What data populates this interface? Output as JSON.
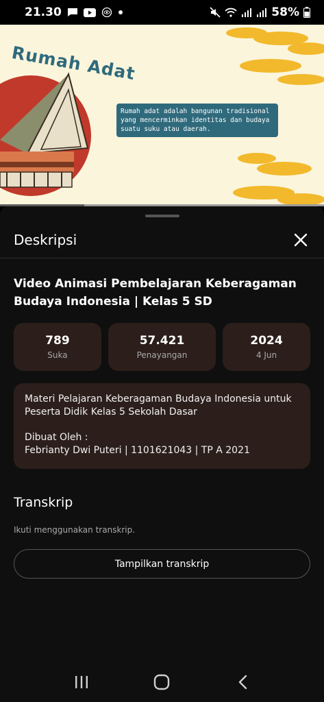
{
  "status_bar": {
    "time": "21.30",
    "battery": "58%",
    "icons": [
      "message-icon",
      "youtube-icon",
      "eye-icon",
      "dot-icon",
      "mute-icon",
      "wifi-icon",
      "signal-icon",
      "signal-icon",
      "battery-icon"
    ]
  },
  "video": {
    "overlay_title": "Rumah Adat",
    "overlay_caption": "Rumah adat adalah bangunan tradisional yang mencerminkan identitas dan budaya suatu suku atau daerah.",
    "progress_fraction": 0.26
  },
  "sheet": {
    "title": "Deskripsi",
    "video_title": "Video Animasi Pembelajaran Keberagaman Budaya Indonesia | Kelas 5 SD",
    "stats": [
      {
        "value": "789",
        "label": "Suka"
      },
      {
        "value": "57.421",
        "label": "Penayangan"
      },
      {
        "value": "2024",
        "label": "4 Jun"
      }
    ],
    "description_line1": "Materi Pelajaran Keberagaman Budaya Indonesia untuk Peserta Didik Kelas 5 Sekolah Dasar",
    "description_line2": "Dibuat Oleh :",
    "description_line3": "Febrianty Dwi Puteri | 1101621043 | TP A 2021",
    "transcript_heading": "Transkrip",
    "transcript_hint": "Ikuti menggunakan transkrip.",
    "transcript_button": "Tampilkan transkrip"
  },
  "colors": {
    "sheet_bg": "#0f0f0f",
    "card_bg": "#2c1f1b",
    "video_bg": "#fbf5dc",
    "accent_teal": "#2f6a7c",
    "accent_red": "#c0392b",
    "cloud_yellow": "#f2b92c"
  }
}
